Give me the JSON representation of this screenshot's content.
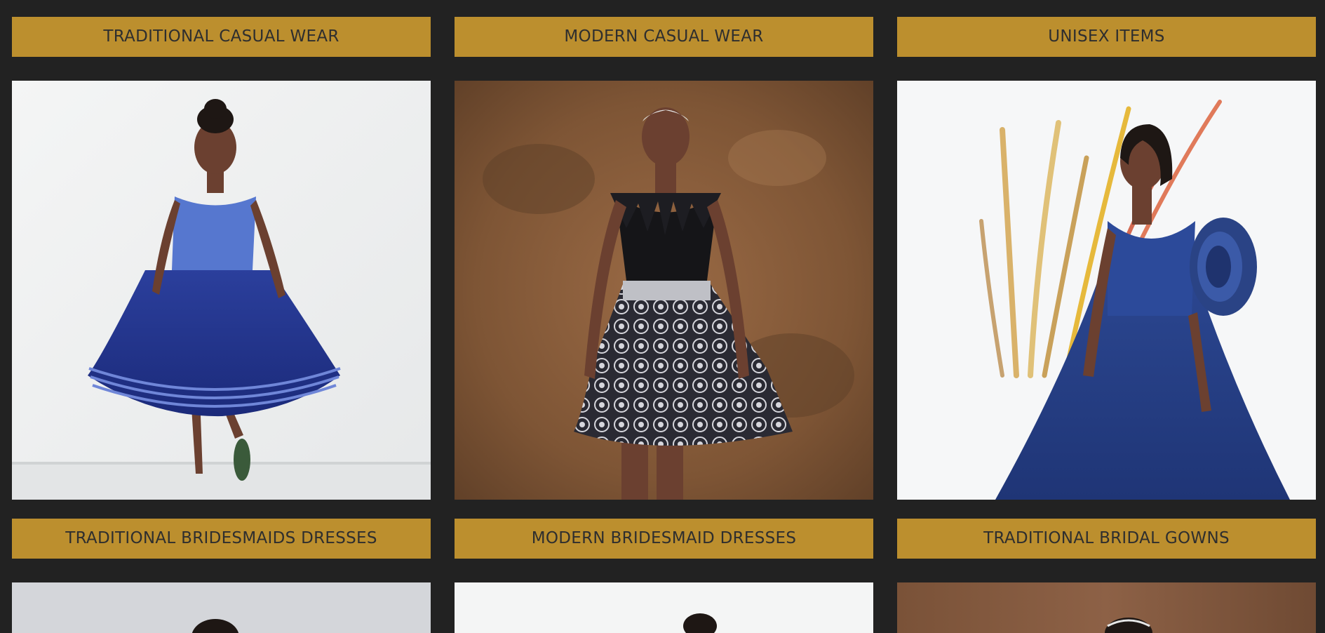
{
  "categories": [
    {
      "label": "TRADITIONAL CASUAL WEAR",
      "image_alt": "Model in blue traditional dress with tulle skirt"
    },
    {
      "label": "MODERN CASUAL WEAR",
      "image_alt": "Model in black feathered bodice with printed skirt"
    },
    {
      "label": "UNISEX ITEMS",
      "image_alt": "Model in navy tulle gown with ruffled shoulder"
    },
    {
      "label": "TRADITIONAL BRIDESMAIDS DRESSES",
      "image_alt": "Bridesmaid dress preview"
    },
    {
      "label": "MODERN BRIDESMAID DRESSES",
      "image_alt": "Modern bridesmaid dress preview"
    },
    {
      "label": "TRADITIONAL BRIDAL GOWNS",
      "image_alt": "Bridal gown preview"
    }
  ],
  "colors": {
    "page_background": "#222222",
    "button_background": "#bc8f2e",
    "button_text": "#2e2e2e"
  }
}
